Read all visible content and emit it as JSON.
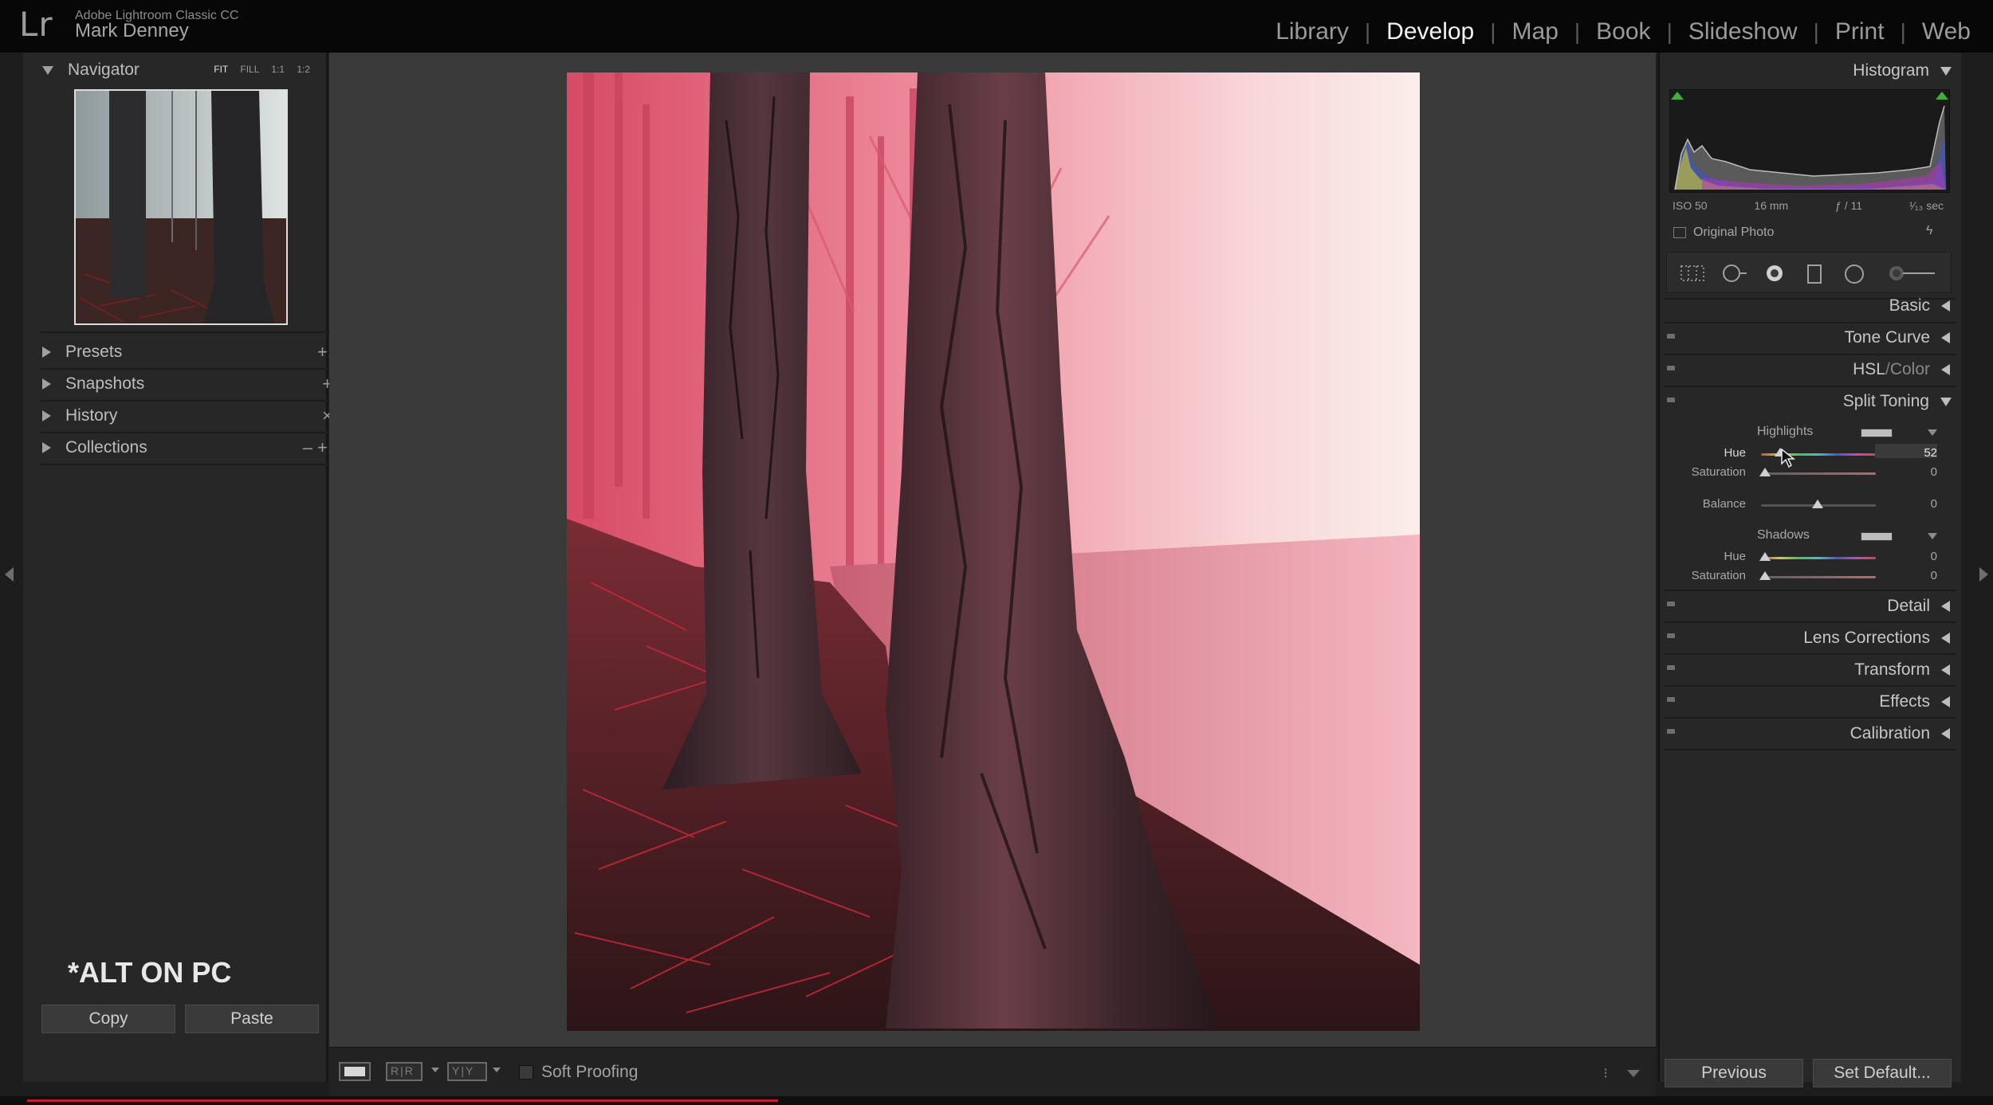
{
  "header": {
    "logo": "Lr",
    "app_name": "Adobe Lightroom Classic CC",
    "user_name": "Mark Denney",
    "modules": [
      "Library",
      "Develop",
      "Map",
      "Book",
      "Slideshow",
      "Print",
      "Web"
    ],
    "active_module": "Develop"
  },
  "left_panel": {
    "navigator": {
      "title": "Navigator",
      "zoom_options": [
        "FIT",
        "FILL",
        "1:1",
        "1:2"
      ],
      "selected_zoom": "FIT"
    },
    "sections": [
      {
        "label": "Presets",
        "action": "+."
      },
      {
        "label": "Snapshots",
        "action": "+"
      },
      {
        "label": "History",
        "action": "×"
      },
      {
        "label": "Collections",
        "action": "–  +."
      }
    ],
    "overlay_note": "*ALT ON PC",
    "copy_label": "Copy",
    "paste_label": "Paste"
  },
  "toolbar": {
    "before_after_label": "R|R",
    "before_after_yy_label": "Y|Y",
    "soft_proofing_label": "Soft Proofing",
    "menu_icon": "⁝"
  },
  "right_panel": {
    "histogram": {
      "title": "Histogram",
      "iso": "ISO 50",
      "focal_length": "16 mm",
      "aperture": "ƒ / 11",
      "shutter": "¹⁄₁₃ sec",
      "original_photo_label": "Original Photo"
    },
    "panels": {
      "basic": "Basic",
      "tone_curve": "Tone Curve",
      "hsl": "HSL",
      "hsl_sep": " / ",
      "color": "Color",
      "split_toning": "Split Toning",
      "detail": "Detail",
      "lens_corrections": "Lens Corrections",
      "transform": "Transform",
      "effects": "Effects",
      "calibration": "Calibration"
    },
    "split_toning": {
      "highlights_label": "Highlights",
      "shadows_label": "Shadows",
      "highlights_hue_label": "Hue",
      "highlights_hue_value": "52",
      "highlights_saturation_label": "Saturation",
      "highlights_saturation_value": "0",
      "balance_label": "Balance",
      "balance_value": "0",
      "shadows_hue_label": "Hue",
      "shadows_hue_value": "0",
      "shadows_saturation_label": "Saturation",
      "shadows_saturation_value": "0"
    },
    "previous_label": "Previous",
    "set_default_label": "Set Default..."
  },
  "colors": {
    "accent_tint": "#e0596f",
    "panel_bg": "#272727",
    "canvas_bg": "#3a3a3a",
    "progress_red": "#c5202a"
  }
}
